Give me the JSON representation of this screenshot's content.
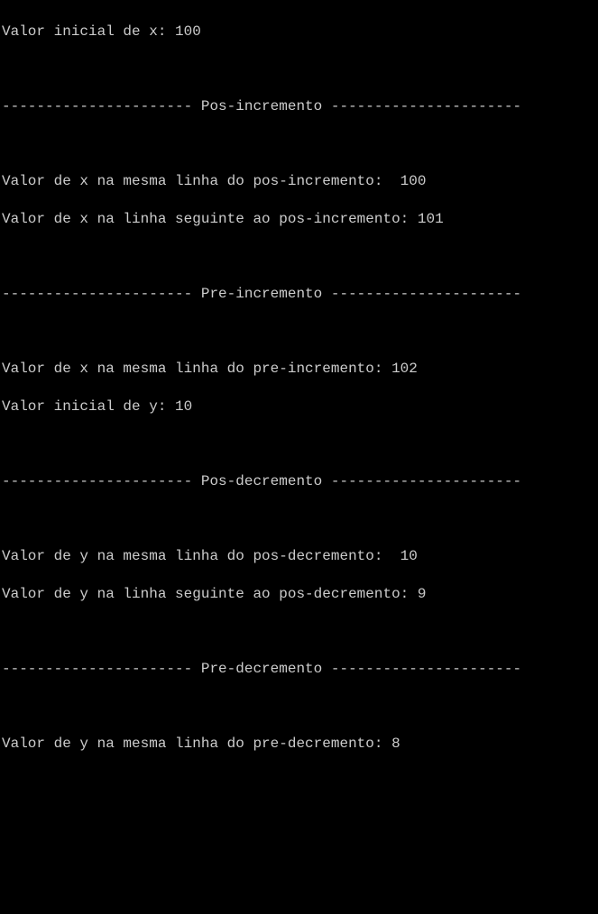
{
  "lines": [
    "Valor inicial de x: 100",
    " ",
    "---------------------- Pos-incremento ----------------------",
    " ",
    "Valor de x na mesma linha do pos-incremento:  100",
    "Valor de x na linha seguinte ao pos-incremento: 101",
    " ",
    "---------------------- Pre-incremento ----------------------",
    " ",
    "Valor de x na mesma linha do pre-incremento: 102",
    "Valor inicial de y: 10",
    " ",
    "---------------------- Pos-decremento ----------------------",
    " ",
    "Valor de y na mesma linha do pos-decremento:  10",
    "Valor de y na linha seguinte ao pos-decremento: 9",
    " ",
    "---------------------- Pre-decremento ----------------------",
    " ",
    "Valor de y na mesma linha do pre-decremento: 8",
    " ",
    " "
  ]
}
